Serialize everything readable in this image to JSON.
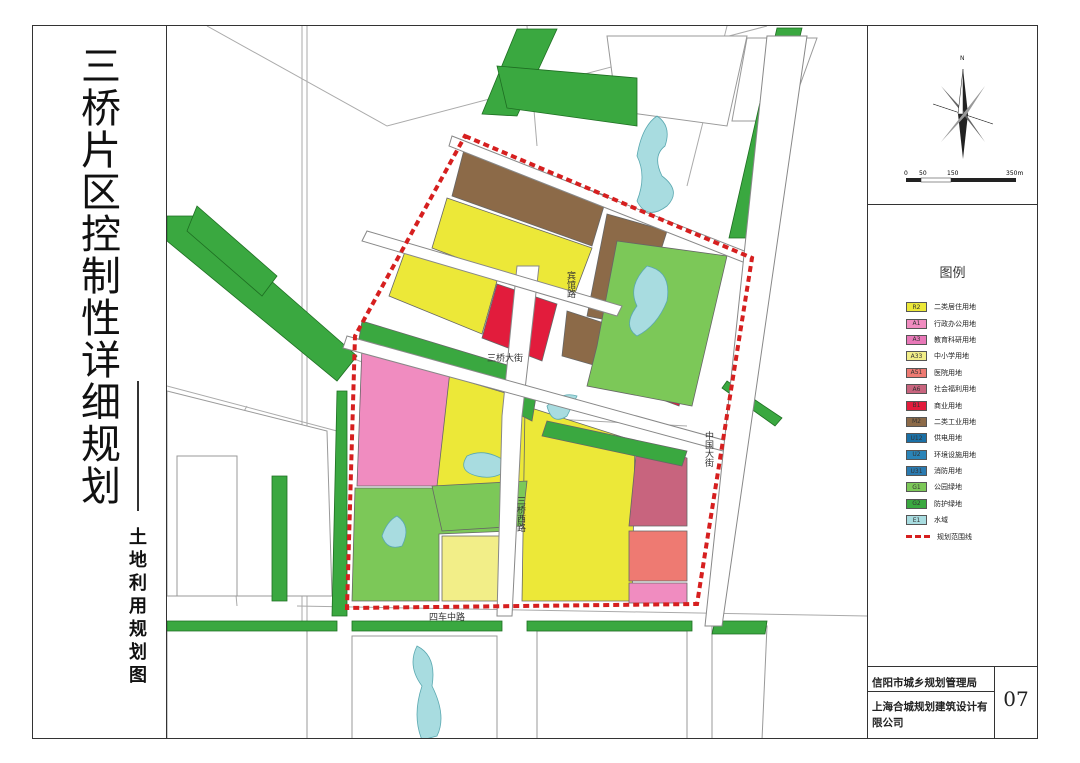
{
  "title": "三桥片区控制性详细规划",
  "subtitle": "土地利用规划图",
  "scale_bar": {
    "labels": [
      "0",
      "50",
      "150",
      "350m"
    ]
  },
  "north_label": "N",
  "legend": {
    "title": "图例",
    "items": [
      {
        "code": "R2",
        "label": "二类居住用地",
        "color": "#ece838"
      },
      {
        "code": "A1",
        "label": "行政办公用地",
        "color": "#f08cc0"
      },
      {
        "code": "A3",
        "label": "教育科研用地",
        "color": "#e878b8"
      },
      {
        "code": "A33",
        "label": "中小学用地",
        "color": "#f2ee88"
      },
      {
        "code": "A51",
        "label": "医院用地",
        "color": "#ee7a72"
      },
      {
        "code": "A6",
        "label": "社会福利用地",
        "color": "#c8647e"
      },
      {
        "code": "B1",
        "label": "商业用地",
        "color": "#e21c3c"
      },
      {
        "code": "M2",
        "label": "二类工业用地",
        "color": "#8c6a48"
      },
      {
        "code": "U12",
        "label": "供电用地",
        "color": "#1a70a6"
      },
      {
        "code": "U2",
        "label": "环境设施用地",
        "color": "#2a84b8"
      },
      {
        "code": "U31",
        "label": "消防用地",
        "color": "#2a7ab0"
      },
      {
        "code": "G1",
        "label": "公园绿地",
        "color": "#7cc858"
      },
      {
        "code": "G2",
        "label": "防护绿地",
        "color": "#3aa840"
      },
      {
        "code": "E1",
        "label": "水域",
        "color": "#a8dce0"
      }
    ],
    "boundary_label": "规划范围线",
    "boundary_color": "#d61f1f"
  },
  "road_labels": [
    "三桥西路",
    "宾馆路",
    "三桥大街",
    "中国大街",
    "四车中路"
  ],
  "organization": {
    "authority": "信阳市城乡规划管理局",
    "designer": "上海合城规划建筑设计有限公司",
    "sheet_number": "07"
  }
}
